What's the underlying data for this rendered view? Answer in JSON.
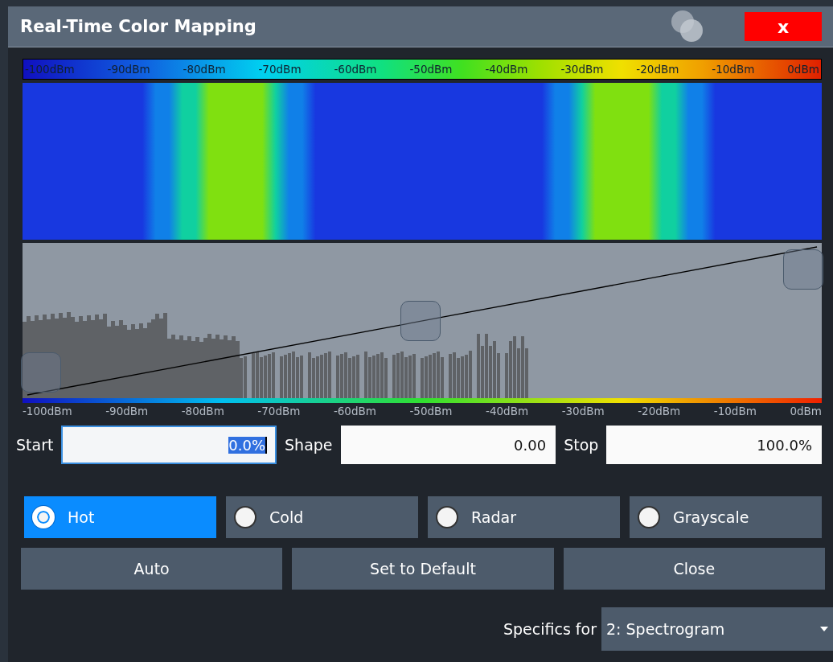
{
  "window": {
    "title": "Real-Time Color Mapping",
    "close": "x"
  },
  "scale_labels": [
    "-100dBm",
    "-90dBm",
    "-80dBm",
    "-70dBm",
    "-60dBm",
    "-50dBm",
    "-40dBm",
    "-30dBm",
    "-20dBm",
    "-10dBm",
    "0dBm"
  ],
  "axis_labels": [
    "-100dBm",
    "-90dBm",
    "-80dBm",
    "-70dBm",
    "-60dBm",
    "-50dBm",
    "-40dBm",
    "-30dBm",
    "-20dBm",
    "-10dBm",
    "0dBm"
  ],
  "fields": [
    {
      "label": "Start",
      "value": "0.0%",
      "focused": true
    },
    {
      "label": "Shape",
      "value": "0.00",
      "focused": false
    },
    {
      "label": "Stop",
      "value": "100.0%",
      "focused": false
    }
  ],
  "color_schemes": [
    {
      "label": "Hot",
      "selected": true
    },
    {
      "label": "Cold",
      "selected": false
    },
    {
      "label": "Radar",
      "selected": false
    },
    {
      "label": "Grayscale",
      "selected": false
    }
  ],
  "buttons": [
    "Auto",
    "Set to Default",
    "Close"
  ],
  "specifics": {
    "label": "Specifics for",
    "value": "2: Spectrogram"
  }
}
